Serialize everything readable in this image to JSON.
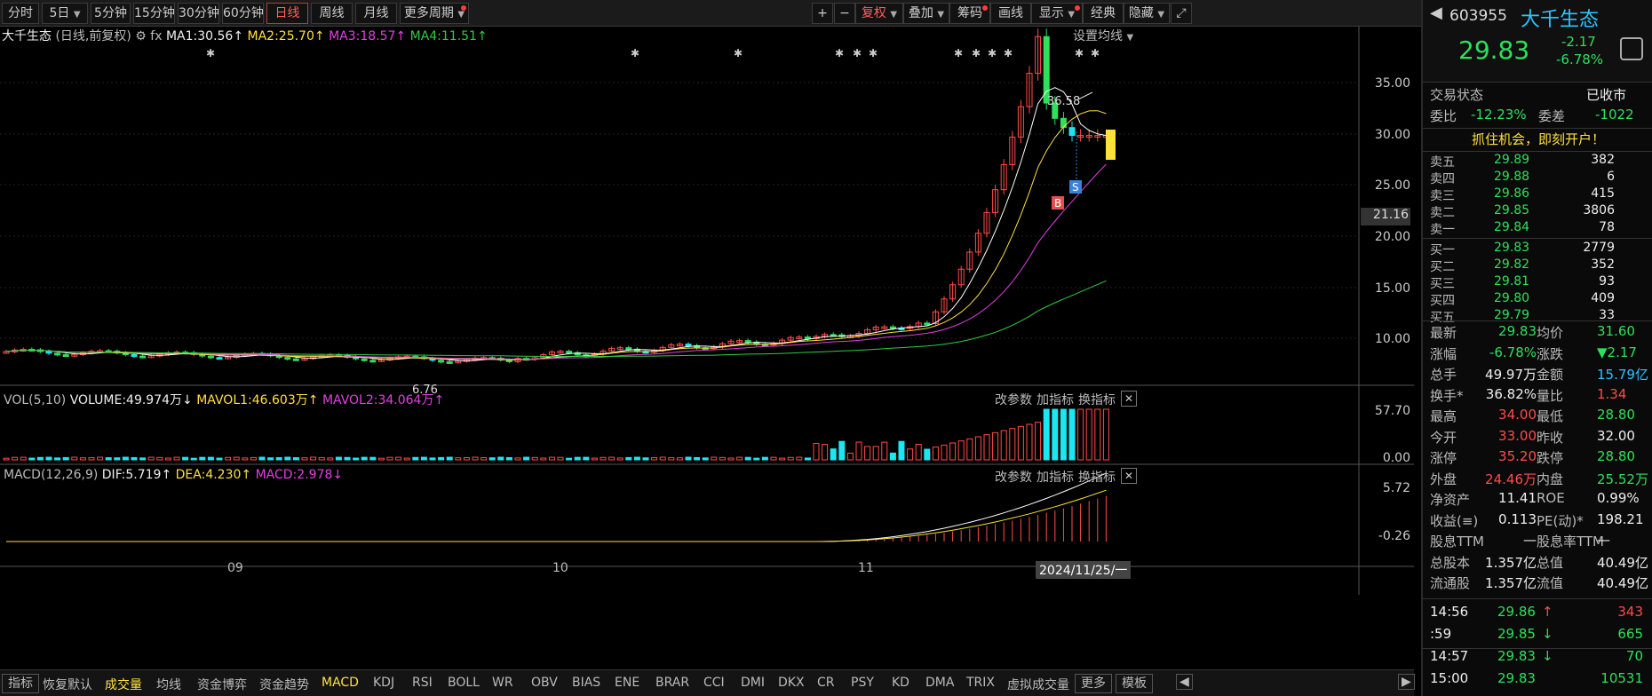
{
  "toolbar": {
    "periods": [
      "分时",
      "5日",
      "5分钟",
      "15分钟",
      "30分钟",
      "60分钟",
      "日线",
      "周线",
      "月线",
      "更多周期"
    ],
    "active_period": "日线",
    "right_buttons": [
      "+",
      "−",
      "复权",
      "叠加",
      "筹码",
      "画线",
      "显示",
      "经典",
      "隐藏"
    ],
    "fullscreen_icon": "expand-icon"
  },
  "chart_header": {
    "name": "大千生态",
    "mode": "(日线,前复权)",
    "ma1": "MA1:30.56",
    "ma2": "MA2:25.70",
    "ma3": "MA3:18.57",
    "ma4": "MA4:11.51",
    "settings": "设置均线"
  },
  "price_axis": [
    "35.00",
    "30.00",
    "25.00",
    "20.00",
    "15.00",
    "10.00"
  ],
  "price_marker": "21.16",
  "annotations": {
    "high": "36.58",
    "low": "6.76",
    "buy": "B",
    "sell": "S"
  },
  "vol_header": {
    "name": "VOL(5,10)",
    "volume": "VOLUME:49.974万",
    "mavol1": "MAVOL1:46.603万",
    "mavol2": "MAVOL2:34.064万"
  },
  "vol_axis": [
    "57.70",
    "0.00"
  ],
  "macd_header": {
    "name": "MACD(12,26,9)",
    "dif": "DIF:5.719",
    "dea": "DEA:4.230",
    "macd": "MACD:2.978"
  },
  "macd_axis": [
    "5.72",
    "-0.26"
  ],
  "panel_buttons": [
    "改参数",
    "加指标",
    "换指标"
  ],
  "time_axis": [
    "09",
    "10",
    "11"
  ],
  "time_cursor": "2024/11/25/一",
  "bottom_tabs": [
    "指标",
    "恢复默认",
    "成交量",
    "均线",
    "资金博弈",
    "资金趋势",
    "MACD",
    "KDJ",
    "RSI",
    "BOLL",
    "WR",
    "OBV",
    "BIAS",
    "ENE",
    "BRAR",
    "CCI",
    "DMI",
    "DKX",
    "CR",
    "PSY",
    "KD",
    "DMA",
    "TRIX",
    "虚拟成交量",
    "更多",
    "模板"
  ],
  "colors": {
    "up": "#ff4b4b",
    "down": "#2ee05a",
    "ma1": "#ffffff",
    "ma2": "#ffe13b",
    "ma3": "#e040e0",
    "ma4": "#2ecc40",
    "cyan": "#1ee6f0"
  },
  "quote": {
    "code": "603955",
    "name": "大千生态",
    "price": "29.83",
    "change": "-2.17",
    "change_pct": "-6.78%",
    "status_label": "交易状态",
    "status_value": "已收市",
    "weibi_label": "委比",
    "weibi_value": "-12.23%",
    "weicha_label": "委差",
    "weicha_value": "-1022",
    "promo": "抓住机会，即刻开户！",
    "asks": [
      {
        "label": "卖五",
        "price": "29.89",
        "vol": "382"
      },
      {
        "label": "卖四",
        "price": "29.88",
        "vol": "6"
      },
      {
        "label": "卖三",
        "price": "29.86",
        "vol": "415"
      },
      {
        "label": "卖二",
        "price": "29.85",
        "vol": "3806"
      },
      {
        "label": "卖一",
        "price": "29.84",
        "vol": "78"
      }
    ],
    "bids": [
      {
        "label": "买一",
        "price": "29.83",
        "vol": "2779"
      },
      {
        "label": "买二",
        "price": "29.82",
        "vol": "352"
      },
      {
        "label": "买三",
        "price": "29.81",
        "vol": "93"
      },
      {
        "label": "买四",
        "price": "29.80",
        "vol": "409"
      },
      {
        "label": "买五",
        "price": "29.79",
        "vol": "33"
      }
    ],
    "stats": [
      {
        "l1": "最新",
        "v1": "29.83",
        "c1": "green",
        "l2": "均价",
        "v2": "31.60",
        "c2": "green"
      },
      {
        "l1": "涨幅",
        "v1": "-6.78%",
        "c1": "green",
        "l2": "涨跌",
        "v2": "▼2.17",
        "c2": "green"
      },
      {
        "l1": "总手",
        "v1": "49.97万",
        "c1": "white",
        "l2": "金额",
        "v2": "15.79亿",
        "c2": "cyan"
      },
      {
        "l1": "换手*",
        "v1": "36.82%",
        "c1": "white",
        "l2": "量比",
        "v2": "1.34",
        "c2": "red"
      },
      {
        "l1": "最高",
        "v1": "34.00",
        "c1": "red",
        "l2": "最低",
        "v2": "28.80",
        "c2": "green"
      },
      {
        "l1": "今开",
        "v1": "33.00",
        "c1": "red",
        "l2": "昨收",
        "v2": "32.00",
        "c2": "white"
      },
      {
        "l1": "涨停",
        "v1": "35.20",
        "c1": "red",
        "l2": "跌停",
        "v2": "28.80",
        "c2": "green"
      },
      {
        "l1": "外盘",
        "v1": "24.46万",
        "c1": "red",
        "l2": "内盘",
        "v2": "25.52万",
        "c2": "green"
      },
      {
        "l1": "净资产",
        "v1": "11.41",
        "c1": "white",
        "l2": "ROE",
        "v2": "0.99%",
        "c2": "white"
      },
      {
        "l1": "收益(≡)",
        "v1": "0.113",
        "c1": "white",
        "l2": "PE(动)*",
        "v2": "198.21",
        "c2": "white"
      },
      {
        "l1": "股息TTM",
        "v1": "—",
        "c1": "white",
        "l2": "股息率TTM",
        "v2": "—",
        "c2": "white"
      },
      {
        "l1": "总股本",
        "v1": "1.357亿",
        "c1": "white",
        "l2": "总值",
        "v2": "40.49亿",
        "c2": "white"
      },
      {
        "l1": "流通股",
        "v1": "1.357亿",
        "c1": "white",
        "l2": "流值",
        "v2": "40.49亿",
        "c2": "white"
      }
    ],
    "ticks": [
      {
        "time": "14:56",
        "price": "29.86",
        "arrow": "↑",
        "vol": "343",
        "pc": "green",
        "ac": "red",
        "vc": "red"
      },
      {
        "time": ":59",
        "price": "29.85",
        "arrow": "↓",
        "vol": "665",
        "pc": "green",
        "ac": "green",
        "vc": "green"
      },
      {
        "time": "14:57",
        "price": "29.83",
        "arrow": "↓",
        "vol": "70",
        "pc": "green",
        "ac": "green",
        "vc": "green"
      },
      {
        "time": "15:00",
        "price": "29.83",
        "arrow": "",
        "vol": "10531",
        "pc": "green",
        "ac": "green",
        "vc": "green"
      }
    ]
  }
}
